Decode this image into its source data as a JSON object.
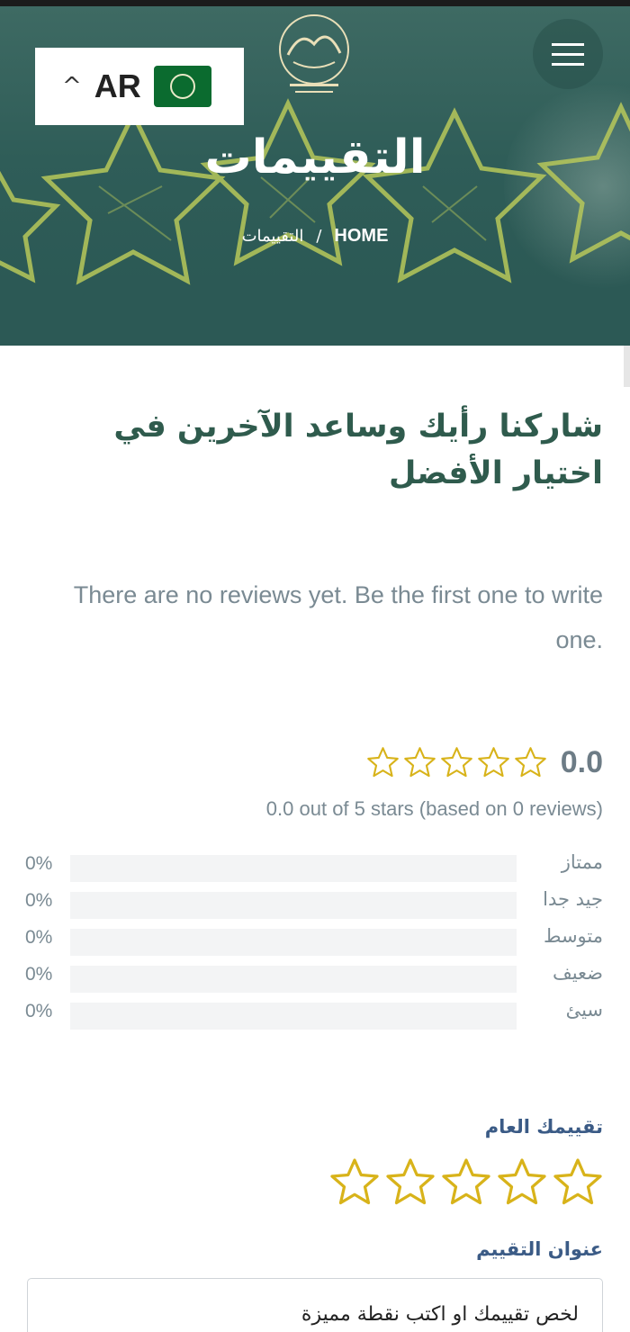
{
  "header": {
    "language": {
      "code": "AR",
      "flag": "arab-league-flag"
    },
    "logo_name": "islamic-identity-logo",
    "menu_icon": "hamburger-icon"
  },
  "hero": {
    "title": "التقييمات",
    "breadcrumb": {
      "home": "HOME",
      "separator": "/",
      "current": "التقييمات"
    }
  },
  "content": {
    "heading": "شاركنا رأيك وساعد الآخرين في اختيار الأفضل",
    "no_reviews": "There are no reviews yet. Be the first one to write one."
  },
  "rating_summary": {
    "average": "0.0",
    "summary": "0.0 out of 5 stars (based on 0 reviews)",
    "max_stars": 5,
    "distribution": [
      {
        "label": "ممتاز",
        "percent": "0%",
        "value": 0
      },
      {
        "label": "جيد جدا",
        "percent": "0%",
        "value": 0
      },
      {
        "label": "متوسط",
        "percent": "0%",
        "value": 0
      },
      {
        "label": "ضعيف",
        "percent": "0%",
        "value": 0
      },
      {
        "label": "سيئ",
        "percent": "0%",
        "value": 0
      }
    ]
  },
  "form": {
    "overall_rating_label": "تقييمك العام",
    "selected_stars": 0,
    "review_title_label": "عنوان التقييم",
    "review_title_placeholder": "لخص تقييمك او اكتب نقطة مميزة",
    "review_title_value": ""
  },
  "colors": {
    "hero_bg": "#2f5d58",
    "heading": "#2f5b4d",
    "label_blue": "#3b5b86",
    "star_gold": "#d8b31a",
    "muted_text": "#7a8a93"
  }
}
